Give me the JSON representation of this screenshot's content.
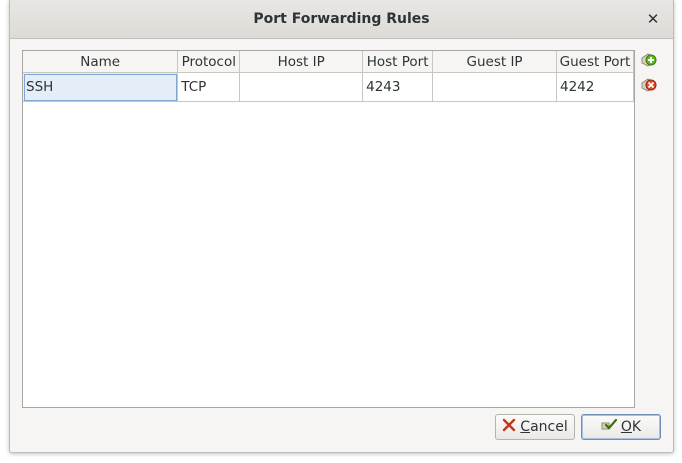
{
  "window": {
    "title": "Port Forwarding Rules",
    "close_icon": "close-icon"
  },
  "table": {
    "columns": [
      "Name",
      "Protocol",
      "Host IP",
      "Host Port",
      "Guest IP",
      "Guest Port"
    ],
    "rows": [
      {
        "name": "SSH",
        "protocol": "TCP",
        "host_ip": "",
        "host_port": "4243",
        "guest_ip": "",
        "guest_port": "4242"
      }
    ]
  },
  "side_buttons": {
    "add_icon": "add-rule-icon",
    "remove_icon": "remove-rule-icon"
  },
  "buttons": {
    "cancel": {
      "mnemonic": "C",
      "rest": "ancel",
      "icon": "cancel-x-icon"
    },
    "ok": {
      "mnemonic": "O",
      "rest": "K",
      "icon": "ok-check-icon"
    }
  },
  "colors": {
    "selection": "#e4eef8",
    "add_green": "#4e9a06",
    "remove_red": "#cc0000"
  }
}
